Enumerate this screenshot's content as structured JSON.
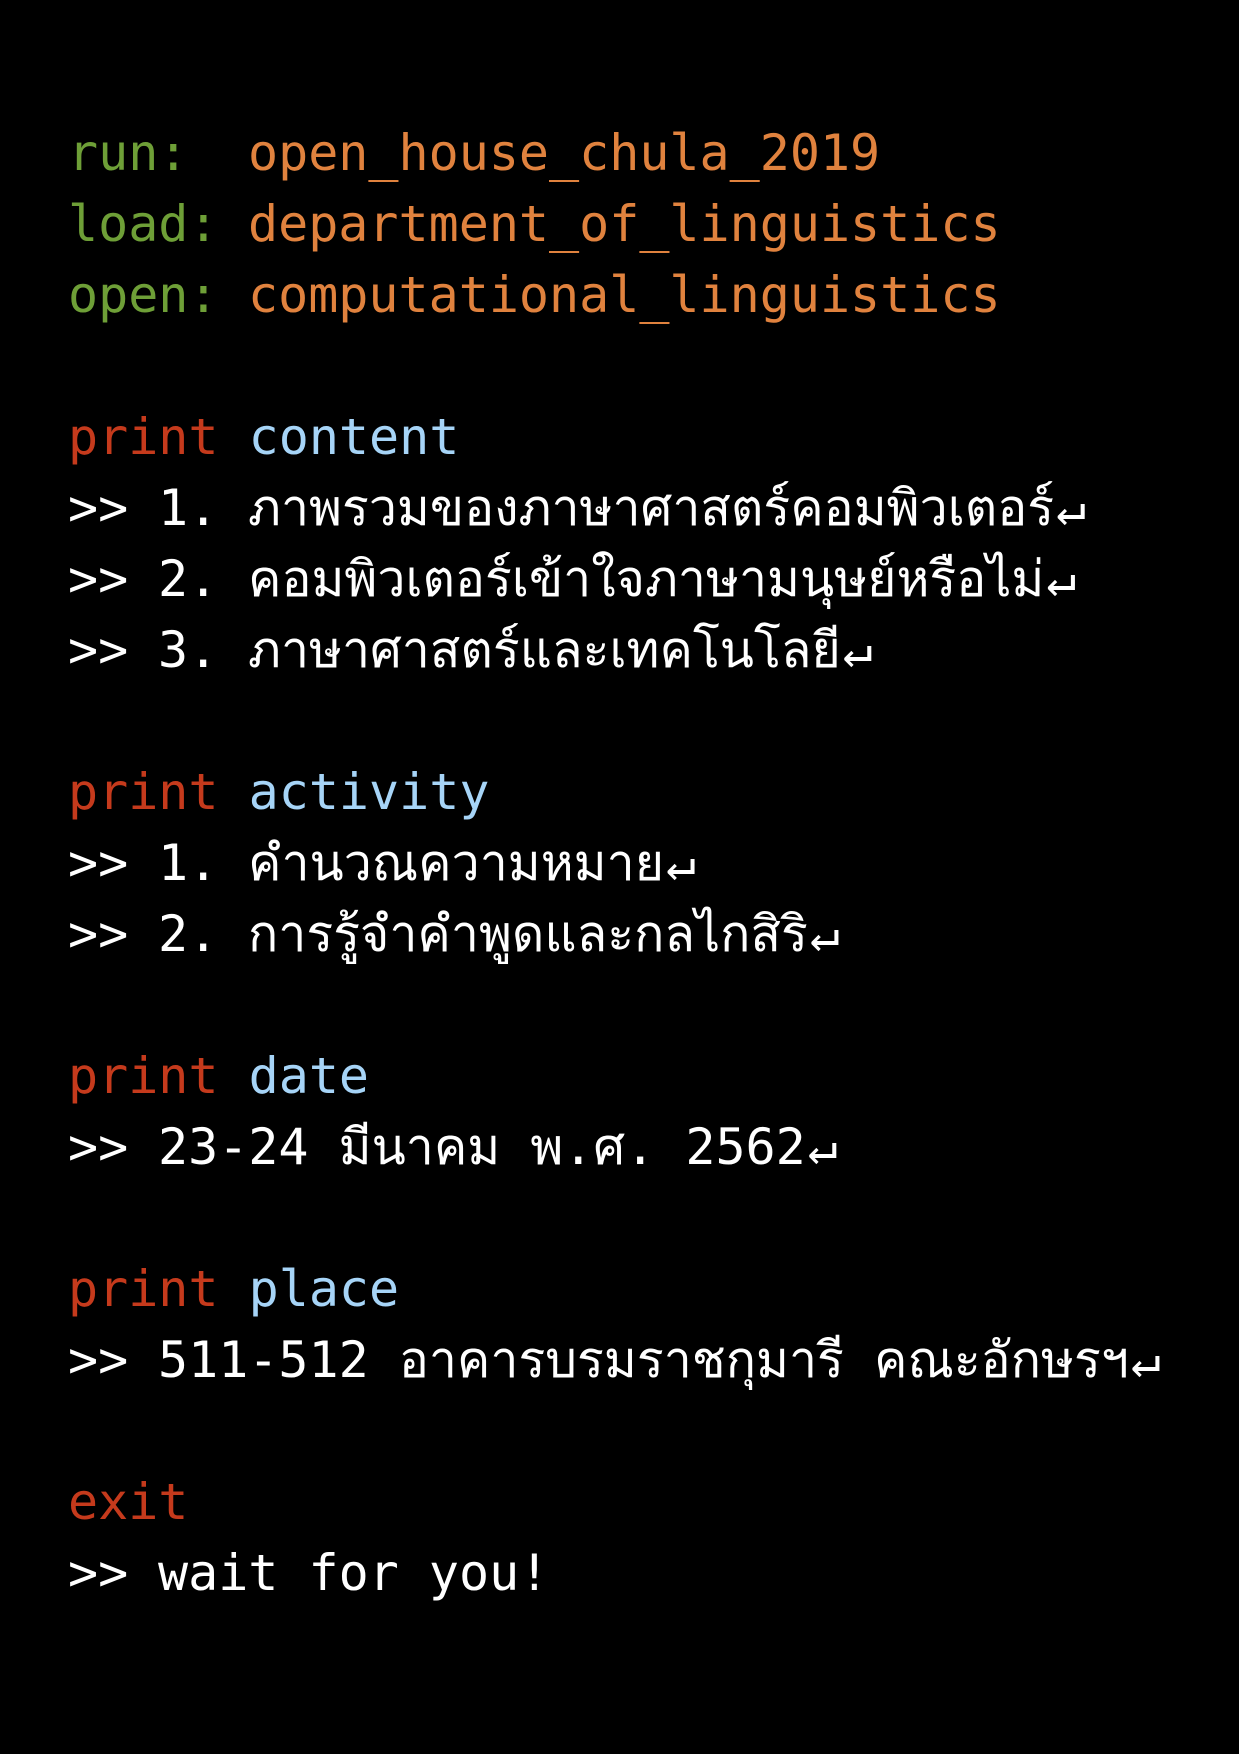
{
  "colors": {
    "background": "#000000",
    "config_key": "#6e9f37",
    "config_value": "#e0823e",
    "command": "#c53a1c",
    "argument": "#a6d4f7",
    "output": "#ffffff"
  },
  "config": [
    {
      "key": "run:",
      "value": "open_house_chula_2019"
    },
    {
      "key": "load:",
      "value": "department_of_linguistics"
    },
    {
      "key": "open:",
      "value": "computational_linguistics"
    }
  ],
  "prompt": ">>",
  "return_symbol": "↵",
  "sections": {
    "content": {
      "command": "print",
      "argument": "content",
      "items": [
        {
          "num": "1.",
          "text": "ภาพรวมของภาษาศาสตร์คอมพิวเตอร์"
        },
        {
          "num": "2.",
          "text": "คอมพิวเตอร์เข้าใจภาษามนุษย์หรือไม่"
        },
        {
          "num": "3.",
          "text": "ภาษาศาสตร์และเทคโนโลยี"
        }
      ]
    },
    "activity": {
      "command": "print",
      "argument": "activity",
      "items": [
        {
          "num": "1.",
          "text": "คำนวณความหมาย"
        },
        {
          "num": "2.",
          "text": "การรู้จำคำพูดและกลไกสิริ"
        }
      ]
    },
    "date": {
      "command": "print",
      "argument": "date",
      "text": "23-24 มีนาคม พ.ศ. 2562"
    },
    "place": {
      "command": "print",
      "argument": "place",
      "text": "511-512 อาคารบรมราชกุมารี คณะอักษรฯ"
    },
    "exit": {
      "command": "exit",
      "text": "wait for you!"
    }
  }
}
